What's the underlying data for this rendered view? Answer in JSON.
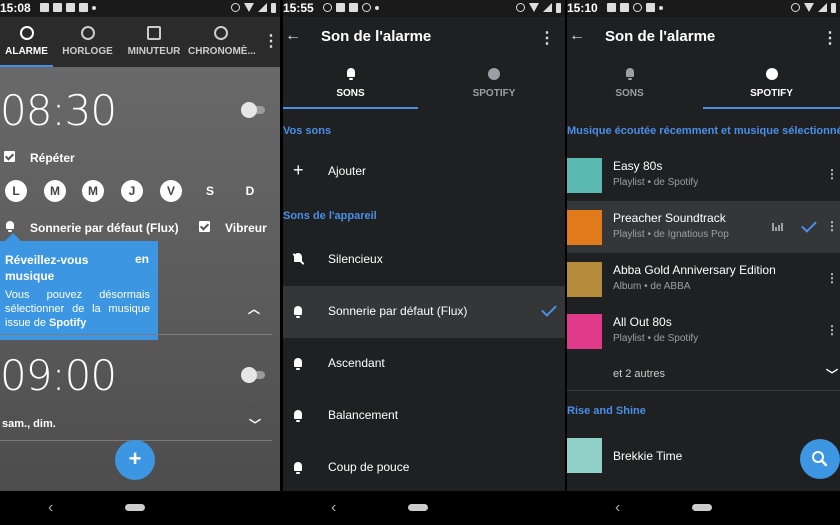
{
  "screen1": {
    "status_time": "15:08",
    "tabs": [
      {
        "label": "ALARME",
        "icon": "alarm-clock-icon"
      },
      {
        "label": "HORLOGE",
        "icon": "clock-icon"
      },
      {
        "label": "MINUTEUR",
        "icon": "hourglass-icon"
      },
      {
        "label": "CHRONOMÈ...",
        "icon": "stopwatch-icon"
      }
    ],
    "alarm1": {
      "time": "08:30",
      "repeat_label": "Répéter",
      "days": [
        "L",
        "M",
        "M",
        "J",
        "V",
        "S",
        "D"
      ],
      "days_active": [
        true,
        true,
        true,
        true,
        true,
        false,
        false
      ],
      "ringtone": "Sonnerie par défaut (Flux)",
      "vibrate_label": "Vibreur"
    },
    "tooltip": {
      "title": "Réveillez-vous",
      "title_en": "en",
      "title_line2": "musique",
      "body_prefix": "Vous pouvez désormais sélectionner de la musique issue de ",
      "body_brand": "Spotify"
    },
    "alarm2": {
      "time": "09:00",
      "days_summary": "sam., dim."
    },
    "fab_label": "+"
  },
  "screen2": {
    "status_time": "15:55",
    "title": "Son de l'alarme",
    "tabs": [
      {
        "label": "SONS",
        "icon": "bell-icon"
      },
      {
        "label": "SPOTIFY",
        "icon": "spotify-icon"
      }
    ],
    "section_your_sounds": "Vos sons",
    "add_label": "Ajouter",
    "section_device_sounds": "Sons de l'appareil",
    "sounds": [
      {
        "label": "Silencieux",
        "icon": "bell-off-icon"
      },
      {
        "label": "Sonnerie par défaut (Flux)",
        "icon": "bell-icon",
        "selected": true
      },
      {
        "label": "Ascendant",
        "icon": "bell-icon"
      },
      {
        "label": "Balancement",
        "icon": "bell-icon"
      },
      {
        "label": "Coup de pouce",
        "icon": "bell-icon"
      }
    ]
  },
  "screen3": {
    "status_time": "15:10",
    "title": "Son de l'alarme",
    "tabs": [
      {
        "label": "SONS",
        "icon": "bell-icon"
      },
      {
        "label": "SPOTIFY",
        "icon": "spotify-icon"
      }
    ],
    "section_recent": "Musique écoutée récemment et musique sélectionnée",
    "playlists": [
      {
        "title": "Easy 80s",
        "subtitle": "Playlist • de Spotify",
        "color": "#5ab9b0"
      },
      {
        "title": "Preacher Soundtrack",
        "subtitle": "Playlist • de Ignatious Pop",
        "color": "#e07a1a",
        "selected": true
      },
      {
        "title": "Abba Gold Anniversary Edition",
        "subtitle": "Album • de ABBA",
        "color": "#b58a3b"
      },
      {
        "title": "All Out 80s",
        "subtitle": "Playlist • de Spotify",
        "color": "#e23a8a"
      }
    ],
    "more_label": "et 2 autres",
    "section_rise": "Rise and Shine",
    "rise_items": [
      {
        "title": "Brekkie Time",
        "color": "#8fd0c8"
      }
    ]
  }
}
